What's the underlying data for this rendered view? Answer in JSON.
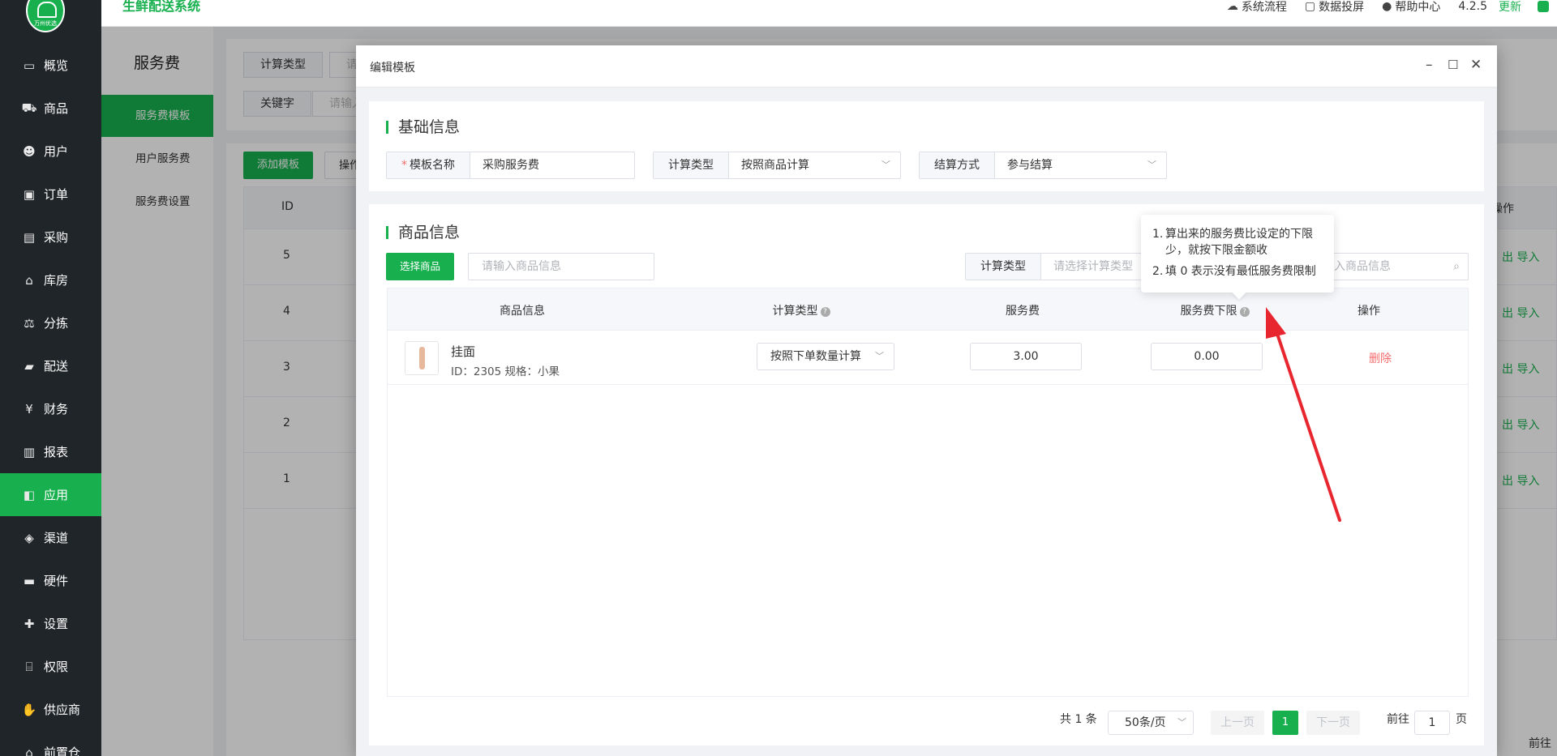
{
  "app": {
    "brand": "生鲜配送系统",
    "logo_text": "万州优选"
  },
  "topbar": {
    "flow": "系统流程",
    "screen": "数据投屏",
    "help": "帮助中心",
    "version": "4.2.5",
    "update": "更新"
  },
  "nav": [
    {
      "label": "概览",
      "icon": "monitor-icon"
    },
    {
      "label": "商品",
      "icon": "cart-icon"
    },
    {
      "label": "用户",
      "icon": "users-icon"
    },
    {
      "label": "订单",
      "icon": "order-icon"
    },
    {
      "label": "采购",
      "icon": "bus-icon"
    },
    {
      "label": "库房",
      "icon": "home-icon"
    },
    {
      "label": "分拣",
      "icon": "scale-icon"
    },
    {
      "label": "配送",
      "icon": "truck-icon"
    },
    {
      "label": "财务",
      "icon": "yen-icon"
    },
    {
      "label": "报表",
      "icon": "bar-chart-icon"
    },
    {
      "label": "应用",
      "icon": "apps-icon"
    },
    {
      "label": "渠道",
      "icon": "cube-icon"
    },
    {
      "label": "硬件",
      "icon": "desktop-icon"
    },
    {
      "label": "设置",
      "icon": "puzzle-icon"
    },
    {
      "label": "权限",
      "icon": "bank-icon"
    },
    {
      "label": "供应商",
      "icon": "handshake-icon"
    },
    {
      "label": "前置仓",
      "icon": "warehouse-icon"
    }
  ],
  "nav_active": "应用",
  "subnav": {
    "title": "服务费",
    "items": [
      "服务费模板",
      "用户服务费",
      "服务费设置"
    ],
    "active": "服务费模板"
  },
  "bg": {
    "filter1_label": "计算类型",
    "filter1_placeholder": "请",
    "filter2_label": "关键字",
    "filter2_placeholder": "请输入",
    "add_button": "添加模板",
    "op_button": "操作",
    "col_id": "ID",
    "col_action": "操作",
    "rows": [
      "5",
      "4",
      "3",
      "2",
      "1"
    ],
    "row_actions": "出  导入",
    "goto": "前往"
  },
  "modal": {
    "title": "编辑模板",
    "basic": {
      "title": "基础信息",
      "name_label": "模板名称",
      "name_value": "采购服务费",
      "calc_label": "计算类型",
      "calc_value": "按照商品计算",
      "settle_label": "结算方式",
      "settle_value": "参与结算"
    },
    "goods": {
      "title": "商品信息",
      "select_button": "选择商品",
      "search_placeholder": "请输入商品信息",
      "calc_filter_label": "计算类型",
      "calc_filter_placeholder": "请选择计算类型",
      "goods_search_placeholder": "入商品信息",
      "columns": [
        "商品信息",
        "计算类型",
        "服务费",
        "服务费下限",
        "操作"
      ],
      "rows": [
        {
          "name": "挂面",
          "meta": "ID：2305   规格：小果",
          "calc_type": "按照下单数量计算",
          "fee": "3.00",
          "min_fee": "0.00",
          "action": "删除"
        }
      ]
    },
    "pager": {
      "total": "共 1 条",
      "page_size": "50条/页",
      "prev": "上一页",
      "current": "1",
      "next": "下一页",
      "goto_prefix": "前往",
      "goto_value": "1",
      "goto_suffix": "页"
    }
  },
  "tooltip": {
    "lines": [
      {
        "num": "1.",
        "text": "算出来的服务费比设定的下限少，就按下限金额收"
      },
      {
        "num": "2.",
        "text": "填 0 表示没有最低服务费限制"
      }
    ]
  },
  "colors": {
    "brand_green": "#18b04f",
    "nav_dark": "#1f2529",
    "danger_red": "#f56c6c",
    "annotation_arrow": "#e8262f"
  }
}
